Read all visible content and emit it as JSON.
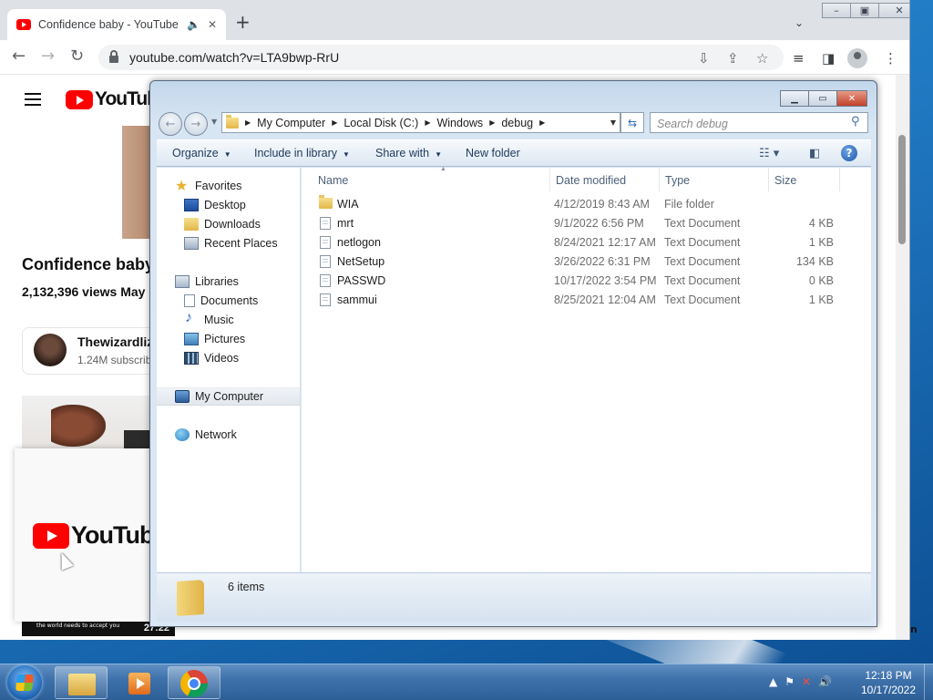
{
  "browser": {
    "tab_title": "Confidence baby - YouTube",
    "url": "youtube.com/watch?v=LTA9bwp-RrU"
  },
  "youtube": {
    "logo_text": "YouTube",
    "video_title": "Confidence baby",
    "video_meta": "2,132,396 views  May",
    "channel_name": "Thewizardliz",
    "channel_subs": "1.24M subscrib",
    "mini_player_caption": "the world needs to accept you",
    "mini_player_time": "27:22",
    "stray_text": "n"
  },
  "explorer": {
    "breadcrumb": [
      "My Computer",
      "Local Disk (C:)",
      "Windows",
      "debug"
    ],
    "search_placeholder": "Search debug",
    "commands": {
      "organize": "Organize",
      "include_in_library": "Include in library",
      "share_with": "Share with",
      "new_folder": "New folder"
    },
    "nav": {
      "favorites": "Favorites",
      "desktop": "Desktop",
      "downloads": "Downloads",
      "recent_places": "Recent Places",
      "libraries": "Libraries",
      "documents": "Documents",
      "music": "Music",
      "pictures": "Pictures",
      "videos": "Videos",
      "my_computer": "My Computer",
      "network": "Network"
    },
    "columns": {
      "name": "Name",
      "date_modified": "Date modified",
      "type": "Type",
      "size": "Size"
    },
    "files": [
      {
        "name": "WIA",
        "date": "4/12/2019 8:43 AM",
        "type": "File folder",
        "size": "",
        "kind": "folder"
      },
      {
        "name": "mrt",
        "date": "9/1/2022 6:56 PM",
        "type": "Text Document",
        "size": "4 KB",
        "kind": "file"
      },
      {
        "name": "netlogon",
        "date": "8/24/2021 12:17 AM",
        "type": "Text Document",
        "size": "1 KB",
        "kind": "file"
      },
      {
        "name": "NetSetup",
        "date": "3/26/2022 6:31 PM",
        "type": "Text Document",
        "size": "134 KB",
        "kind": "file"
      },
      {
        "name": "PASSWD",
        "date": "10/17/2022 3:54 PM",
        "type": "Text Document",
        "size": "0 KB",
        "kind": "file"
      },
      {
        "name": "sammui",
        "date": "8/25/2021 12:04 AM",
        "type": "Text Document",
        "size": "1 KB",
        "kind": "file"
      }
    ],
    "item_count": "6 items"
  },
  "taskbar": {
    "time": "12:18 PM",
    "date": "10/17/2022"
  }
}
